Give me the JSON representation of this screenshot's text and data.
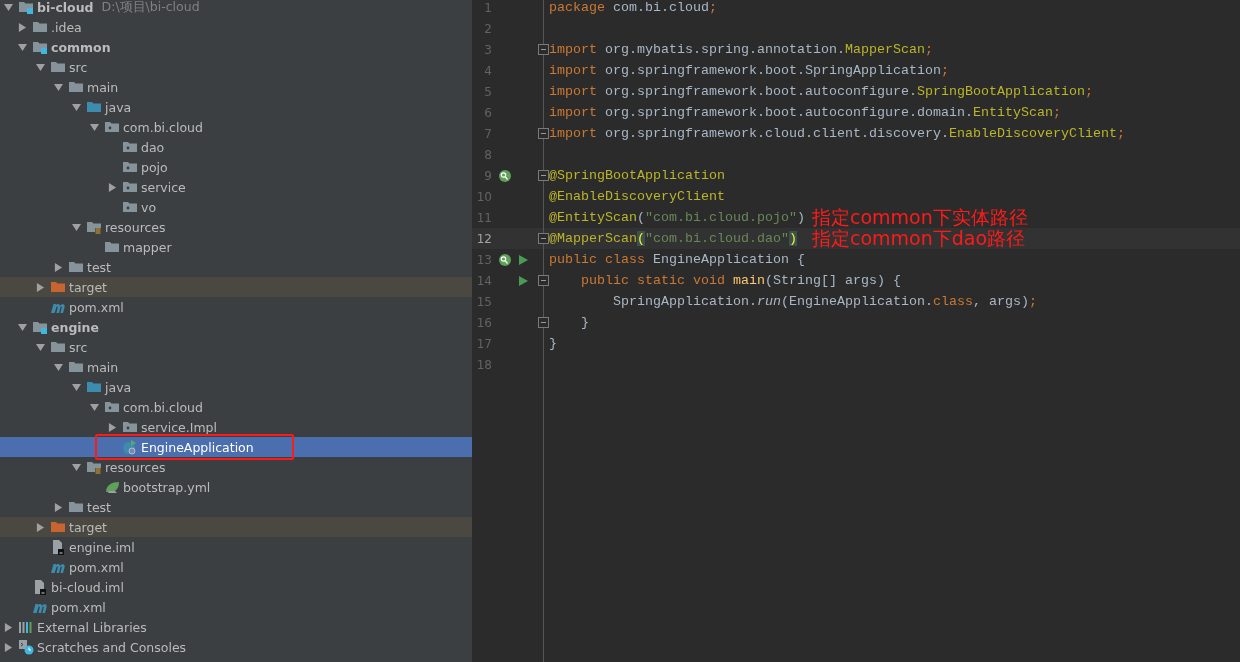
{
  "project_tree": {
    "items": [
      {
        "name": "bi-cloud",
        "hint": "D:\\项目\\bi-cloud",
        "kind": "module",
        "bold": true,
        "expanded": true,
        "selected": false,
        "children": [
          {
            "name": ".idea",
            "kind": "folder",
            "expanded": false,
            "selected": false
          },
          {
            "name": "common",
            "kind": "module",
            "bold": true,
            "expanded": true,
            "selected": false,
            "children": [
              {
                "name": "src",
                "kind": "folder",
                "expanded": true,
                "selected": false,
                "children": [
                  {
                    "name": "main",
                    "kind": "folder",
                    "expanded": true,
                    "selected": false,
                    "children": [
                      {
                        "name": "java",
                        "kind": "source-folder",
                        "expanded": true,
                        "selected": false,
                        "children": [
                          {
                            "name": "com.bi.cloud",
                            "kind": "package",
                            "expanded": true,
                            "selected": false,
                            "children": [
                              {
                                "name": "dao",
                                "kind": "package",
                                "selected": false
                              },
                              {
                                "name": "pojo",
                                "kind": "package",
                                "selected": false
                              },
                              {
                                "name": "service",
                                "kind": "package",
                                "expanded": false,
                                "selected": false
                              },
                              {
                                "name": "vo",
                                "kind": "package",
                                "selected": false
                              }
                            ]
                          }
                        ]
                      },
                      {
                        "name": "resources",
                        "kind": "resource-folder",
                        "expanded": true,
                        "selected": false,
                        "children": [
                          {
                            "name": "mapper",
                            "kind": "folder",
                            "selected": false
                          }
                        ]
                      }
                    ]
                  },
                  {
                    "name": "test",
                    "kind": "folder",
                    "expanded": false,
                    "selected": false
                  }
                ]
              },
              {
                "name": "target",
                "kind": "excluded-folder",
                "expanded": false,
                "selected": false
              },
              {
                "name": "pom.xml",
                "kind": "maven",
                "selected": false
              }
            ]
          },
          {
            "name": "engine",
            "kind": "module",
            "bold": true,
            "expanded": true,
            "selected": false,
            "children": [
              {
                "name": "src",
                "kind": "folder",
                "expanded": true,
                "selected": false,
                "children": [
                  {
                    "name": "main",
                    "kind": "folder",
                    "expanded": true,
                    "selected": false,
                    "children": [
                      {
                        "name": "java",
                        "kind": "source-folder",
                        "expanded": true,
                        "selected": false,
                        "children": [
                          {
                            "name": "com.bi.cloud",
                            "kind": "package",
                            "expanded": true,
                            "selected": false,
                            "children": [
                              {
                                "name": "service.Impl",
                                "kind": "package",
                                "expanded": false,
                                "selected": false
                              },
                              {
                                "name": "EngineApplication",
                                "kind": "spring-class",
                                "selected": true,
                                "boxed": true
                              }
                            ]
                          }
                        ]
                      },
                      {
                        "name": "resources",
                        "kind": "resource-folder",
                        "expanded": true,
                        "selected": false,
                        "children": [
                          {
                            "name": "bootstrap.yml",
                            "kind": "yml",
                            "selected": false
                          }
                        ]
                      }
                    ]
                  },
                  {
                    "name": "test",
                    "kind": "folder",
                    "expanded": false,
                    "selected": false
                  }
                ]
              },
              {
                "name": "target",
                "kind": "excluded-folder",
                "expanded": false,
                "selected": false
              },
              {
                "name": "engine.iml",
                "kind": "iml",
                "selected": false
              },
              {
                "name": "pom.xml",
                "kind": "maven",
                "selected": false
              }
            ]
          },
          {
            "name": "bi-cloud.iml",
            "kind": "iml",
            "selected": false
          },
          {
            "name": "pom.xml",
            "kind": "maven",
            "selected": false
          }
        ]
      },
      {
        "name": "External Libraries",
        "kind": "libraries",
        "expanded": false,
        "selected": false
      },
      {
        "name": "Scratches and Consoles",
        "kind": "scratches",
        "expanded": false,
        "selected": false
      }
    ]
  },
  "editor": {
    "lines": [
      {
        "number": "1",
        "current": false,
        "tokens": [
          {
            "text": "package",
            "kind": "kw"
          },
          {
            "text": " com.bi.cloud",
            "kind": "plain"
          },
          {
            "text": ";",
            "kind": "kw"
          }
        ]
      },
      {
        "number": "2",
        "current": false
      },
      {
        "number": "3",
        "current": false,
        "fold": true,
        "tokens": [
          {
            "text": "import",
            "kind": "kw"
          },
          {
            "text": " org.mybatis.spring.annotation.",
            "kind": "plain"
          },
          {
            "text": "MapperScan",
            "kind": "ann"
          },
          {
            "text": ";",
            "kind": "kw"
          }
        ]
      },
      {
        "number": "4",
        "current": false,
        "tokens": [
          {
            "text": "import",
            "kind": "kw"
          },
          {
            "text": " org.springframework.boot.SpringApplication",
            "kind": "plain"
          },
          {
            "text": ";",
            "kind": "kw"
          }
        ]
      },
      {
        "number": "5",
        "current": false,
        "tokens": [
          {
            "text": "import",
            "kind": "kw"
          },
          {
            "text": " org.springframework.boot.autoconfigure.",
            "kind": "plain"
          },
          {
            "text": "SpringBootApplication",
            "kind": "ann"
          },
          {
            "text": ";",
            "kind": "kw"
          }
        ]
      },
      {
        "number": "6",
        "current": false,
        "tokens": [
          {
            "text": "import",
            "kind": "kw"
          },
          {
            "text": " org.springframework.boot.autoconfigure.domain.",
            "kind": "plain"
          },
          {
            "text": "EntityScan",
            "kind": "ann"
          },
          {
            "text": ";",
            "kind": "kw"
          }
        ]
      },
      {
        "number": "7",
        "current": false,
        "fold": true,
        "tokens": [
          {
            "text": "import",
            "kind": "kw"
          },
          {
            "text": " org.springframework.cloud.client.discovery.",
            "kind": "plain"
          },
          {
            "text": "EnableDiscoveryClient",
            "kind": "ann"
          },
          {
            "text": ";",
            "kind": "kw"
          }
        ]
      },
      {
        "number": "8",
        "current": false
      },
      {
        "number": "9",
        "current": false,
        "fold": true,
        "bean_marker": true,
        "tokens": [
          {
            "text": "@SpringBootApplication",
            "kind": "ann"
          }
        ]
      },
      {
        "number": "10",
        "current": false,
        "tokens": [
          {
            "text": "@EnableDiscoveryClient",
            "kind": "ann"
          }
        ]
      },
      {
        "number": "11",
        "current": false,
        "note": "指定common下实体路径",
        "tokens": [
          {
            "text": "@EntityScan",
            "kind": "ann"
          },
          {
            "text": "(",
            "kind": "plain"
          },
          {
            "text": "\"com.bi.cloud.pojo\"",
            "kind": "str"
          },
          {
            "text": ")",
            "kind": "plain"
          }
        ]
      },
      {
        "number": "12",
        "current": true,
        "fold": true,
        "note": "指定common下dao路径",
        "tokens": [
          {
            "text": "@MapperScan",
            "kind": "ann"
          },
          {
            "text": "(",
            "kind": "match"
          },
          {
            "text": "\"com.bi.cloud.dao\"",
            "kind": "str"
          },
          {
            "text": ")",
            "kind": "match"
          }
        ]
      },
      {
        "number": "13",
        "current": false,
        "bean_marker": true,
        "run_marker": true,
        "tokens": [
          {
            "text": "public class",
            "kind": "kw"
          },
          {
            "text": " EngineApplication {",
            "kind": "plain"
          }
        ]
      },
      {
        "number": "14",
        "current": false,
        "fold": true,
        "run_marker": true,
        "tokens": [
          {
            "text": "    public static void ",
            "kind": "kw"
          },
          {
            "text": "main",
            "kind": "method"
          },
          {
            "text": "(String[] args) {",
            "kind": "plain"
          }
        ]
      },
      {
        "number": "15",
        "current": false,
        "tokens": [
          {
            "text": "        SpringApplication.",
            "kind": "plain"
          },
          {
            "text": "run",
            "kind": "italic"
          },
          {
            "text": "(EngineApplication.",
            "kind": "plain"
          },
          {
            "text": "class",
            "kind": "kw"
          },
          {
            "text": ", args)",
            "kind": "plain"
          },
          {
            "text": ";",
            "kind": "kw"
          }
        ]
      },
      {
        "number": "16",
        "current": false,
        "fold": true,
        "tokens": [
          {
            "text": "    }",
            "kind": "plain"
          }
        ]
      },
      {
        "number": "17",
        "current": false,
        "tokens": [
          {
            "text": "}",
            "kind": "plain"
          }
        ]
      },
      {
        "number": "18",
        "current": false
      }
    ]
  }
}
